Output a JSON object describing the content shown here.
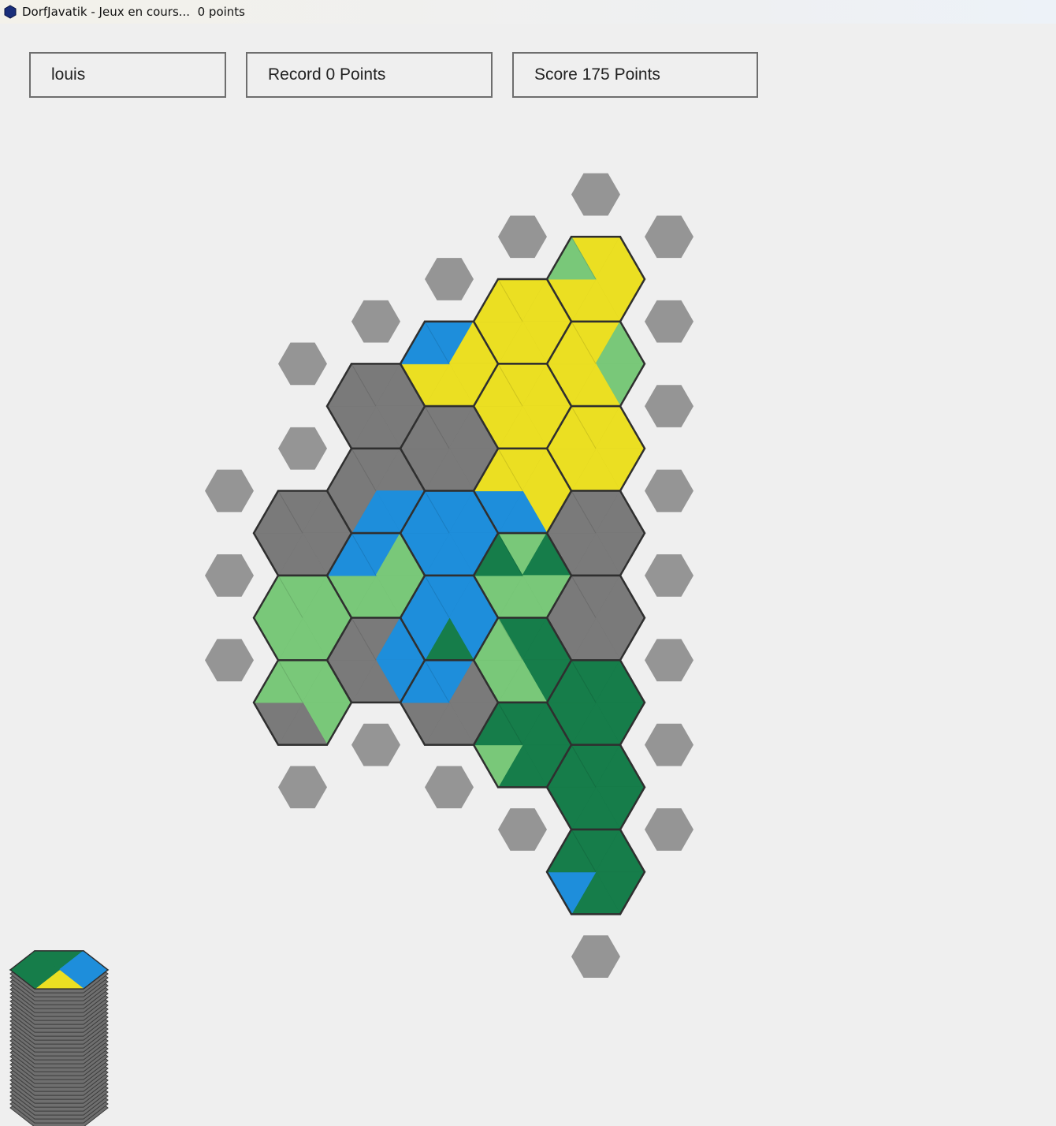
{
  "window": {
    "title": "DorfJavatik - Jeux en cours...  0 points"
  },
  "header": {
    "player_name": "louis",
    "record_label": "Record 0 Points",
    "score_label": "Score 175 Points"
  },
  "colors": {
    "mountain": "#7a7a7a",
    "field": "#ebdf22",
    "water": "#1e8edb",
    "meadow": "#79c879",
    "forest": "#167d4a",
    "placeholder": "#959595",
    "background": "#efefef",
    "tile_border": "#2f2f2f"
  },
  "board": {
    "orientation": "flat-top hexes, origin tile at column 0 row 0",
    "placed_tiles": [
      {
        "col": 0,
        "row": 0,
        "sides": [
          "field",
          "field",
          "field",
          "field",
          "field",
          "meadow"
        ]
      },
      {
        "col": 0,
        "row": 1,
        "sides": [
          "field",
          "meadow",
          "meadow",
          "field",
          "field",
          "field"
        ]
      },
      {
        "col": 0,
        "row": 2,
        "sides": [
          "field",
          "field",
          "field",
          "field",
          "field",
          "field"
        ]
      },
      {
        "col": 0,
        "row": 3,
        "sides": [
          "mountain",
          "mountain",
          "mountain",
          "mountain",
          "mountain",
          "mountain"
        ]
      },
      {
        "col": 0,
        "row": 4,
        "sides": [
          "mountain",
          "mountain",
          "mountain",
          "mountain",
          "mountain",
          "mountain"
        ]
      },
      {
        "col": 0,
        "row": 5,
        "sides": [
          "forest",
          "forest",
          "forest",
          "forest",
          "forest",
          "forest"
        ]
      },
      {
        "col": 0,
        "row": 6,
        "sides": [
          "forest",
          "forest",
          "forest",
          "forest",
          "forest",
          "forest"
        ]
      },
      {
        "col": 0,
        "row": 7,
        "sides": [
          "forest",
          "forest",
          "forest",
          "forest",
          "water",
          "forest"
        ]
      },
      {
        "col": -1,
        "row": 1,
        "sides": [
          "field",
          "field",
          "field",
          "field",
          "field",
          "field"
        ]
      },
      {
        "col": -1,
        "row": 2,
        "sides": [
          "field",
          "field",
          "field",
          "field",
          "field",
          "field"
        ]
      },
      {
        "col": -1,
        "row": 3,
        "sides": [
          "field",
          "field",
          "field",
          "water",
          "water",
          "field"
        ]
      },
      {
        "col": -1,
        "row": 4,
        "sides": [
          "meadow",
          "forest",
          "meadow",
          "meadow",
          "meadow",
          "forest"
        ]
      },
      {
        "col": -1,
        "row": 5,
        "sides": [
          "forest",
          "forest",
          "forest",
          "meadow",
          "meadow",
          "meadow"
        ]
      },
      {
        "col": -1,
        "row": 6,
        "sides": [
          "forest",
          "forest",
          "forest",
          "forest",
          "meadow",
          "forest"
        ]
      },
      {
        "col": -2,
        "row": 1,
        "sides": [
          "water",
          "field",
          "field",
          "field",
          "field",
          "water"
        ]
      },
      {
        "col": -2,
        "row": 2,
        "sides": [
          "mountain",
          "mountain",
          "mountain",
          "mountain",
          "mountain",
          "mountain"
        ]
      },
      {
        "col": -2,
        "row": 3,
        "sides": [
          "water",
          "water",
          "water",
          "water",
          "water",
          "water"
        ]
      },
      {
        "col": -2,
        "row": 4,
        "sides": [
          "water",
          "water",
          "water",
          "forest",
          "water",
          "water"
        ]
      },
      {
        "col": -2,
        "row": 5,
        "sides": [
          "water",
          "mountain",
          "mountain",
          "mountain",
          "mountain",
          "water"
        ]
      },
      {
        "col": -3,
        "row": 2,
        "sides": [
          "mountain",
          "mountain",
          "mountain",
          "mountain",
          "mountain",
          "mountain"
        ]
      },
      {
        "col": -3,
        "row": 3,
        "sides": [
          "mountain",
          "mountain",
          "water",
          "water",
          "mountain",
          "mountain"
        ]
      },
      {
        "col": -3,
        "row": 4,
        "sides": [
          "water",
          "meadow",
          "meadow",
          "meadow",
          "meadow",
          "water"
        ]
      },
      {
        "col": -3,
        "row": 5,
        "sides": [
          "mountain",
          "water",
          "water",
          "mountain",
          "mountain",
          "mountain"
        ]
      },
      {
        "col": -4,
        "row": 3,
        "sides": [
          "mountain",
          "mountain",
          "mountain",
          "mountain",
          "mountain",
          "mountain"
        ]
      },
      {
        "col": -4,
        "row": 4,
        "sides": [
          "meadow",
          "meadow",
          "meadow",
          "meadow",
          "meadow",
          "meadow"
        ]
      },
      {
        "col": -4,
        "row": 5,
        "sides": [
          "meadow",
          "meadow",
          "meadow",
          "mountain",
          "mountain",
          "meadow"
        ]
      }
    ],
    "empty_slots": [
      {
        "col": 0,
        "row": -1
      },
      {
        "col": 0,
        "row": 8
      },
      {
        "col": 1,
        "row": 0
      },
      {
        "col": 1,
        "row": 1
      },
      {
        "col": 1,
        "row": 2
      },
      {
        "col": 1,
        "row": 3
      },
      {
        "col": 1,
        "row": 4
      },
      {
        "col": 1,
        "row": 5
      },
      {
        "col": 1,
        "row": 6
      },
      {
        "col": 1,
        "row": 7
      },
      {
        "col": -1,
        "row": 0
      },
      {
        "col": -1,
        "row": 7
      },
      {
        "col": -2,
        "row": 0
      },
      {
        "col": -2,
        "row": 6
      },
      {
        "col": -3,
        "row": 1
      },
      {
        "col": -3,
        "row": 6
      },
      {
        "col": -4,
        "row": 1
      },
      {
        "col": -4,
        "row": 2
      },
      {
        "col": -4,
        "row": 6
      },
      {
        "col": -5,
        "row": 3
      },
      {
        "col": -5,
        "row": 4
      },
      {
        "col": -5,
        "row": 5
      }
    ]
  },
  "tile_stack": {
    "remaining_tiles": 36,
    "next_tile_sides": [
      "forest",
      "water",
      "water",
      "field",
      "forest",
      "forest"
    ]
  }
}
